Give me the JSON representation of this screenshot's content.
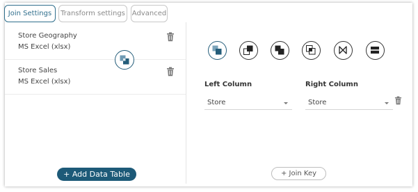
{
  "tabs": [
    {
      "label": "Join Settings",
      "active": true
    },
    {
      "label": "Transform settings",
      "active": false
    },
    {
      "label": "Advanced",
      "active": false
    }
  ],
  "data_tables": [
    {
      "name": "Store Geography",
      "type": "MS Excel (xlsx)"
    },
    {
      "name": "Store Sales",
      "type": "MS Excel (xlsx)"
    }
  ],
  "add_table_label": "+ Add Data Table",
  "join_types": [
    "inner-join-icon",
    "left-join-icon",
    "right-join-icon",
    "outer-join-icon",
    "natural-join-icon",
    "union-icon"
  ],
  "columns": {
    "left_label": "Left Column",
    "right_label": "Right Column",
    "left_value": "Store",
    "right_value": "Store"
  },
  "join_key_label": "+ Join Key",
  "colors": {
    "accent": "#1d5a78",
    "tab_active": "#2f6e8c"
  }
}
